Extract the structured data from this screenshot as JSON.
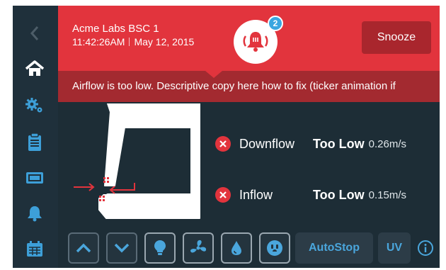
{
  "alert": {
    "device_name": "Acme Labs BSC 1",
    "time": "11:42:26AM",
    "date": "May 12, 2015",
    "badge_count": "2",
    "snooze_label": "Snooze",
    "ticker_text": "Airflow is too low. Descriptive copy here how to fix (ticker animation if"
  },
  "readings": [
    {
      "label": "Downflow",
      "status": "Too Low",
      "value": "0.26m/s"
    },
    {
      "label": "Inflow",
      "status": "Too Low",
      "value": "0.15m/s"
    }
  ],
  "sidebar": {
    "items": [
      "chevron-left-icon",
      "home-icon",
      "settings-gears-icon",
      "clipboard-icon",
      "display-icon",
      "bell-icon",
      "calendar-icon"
    ],
    "active": "home-icon"
  },
  "bottom_bar": {
    "autostop_label": "AutoStop",
    "uv_label": "UV",
    "icons": [
      "chevron-up-icon",
      "chevron-down-icon",
      "light-bulb-icon",
      "fan-icon",
      "water-drop-icon",
      "outlet-icon",
      "info-icon"
    ]
  },
  "colors": {
    "alert_red": "#e2343d",
    "ticker_red": "#a32a30",
    "background": "#1d2d36",
    "accent_blue": "#4aa6dc"
  }
}
